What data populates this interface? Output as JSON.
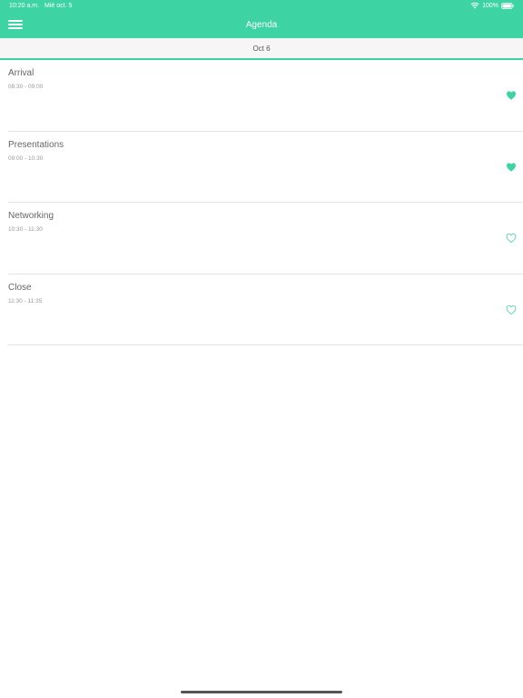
{
  "status_bar": {
    "time": "10:20 a.m.",
    "date": "Mié oct. 5",
    "battery": "100%"
  },
  "header": {
    "title": "Agenda",
    "menu_icon": "hamburger-menu-icon"
  },
  "date_tabs": [
    {
      "label": "Oct 6",
      "selected": true
    }
  ],
  "agenda": [
    {
      "title": "Arrival",
      "time": "08:30 - 09:00",
      "favorite": true
    },
    {
      "title": "Presentations",
      "time": "09:00 - 10:30",
      "favorite": true
    },
    {
      "title": "Networking",
      "time": "10:30 - 11:30",
      "favorite": false
    },
    {
      "title": "Close",
      "time": "11:30 - 11:35",
      "favorite": false
    }
  ],
  "colors": {
    "accent": "#3dd3a3",
    "text_primary": "#666666",
    "text_secondary": "#999999"
  }
}
